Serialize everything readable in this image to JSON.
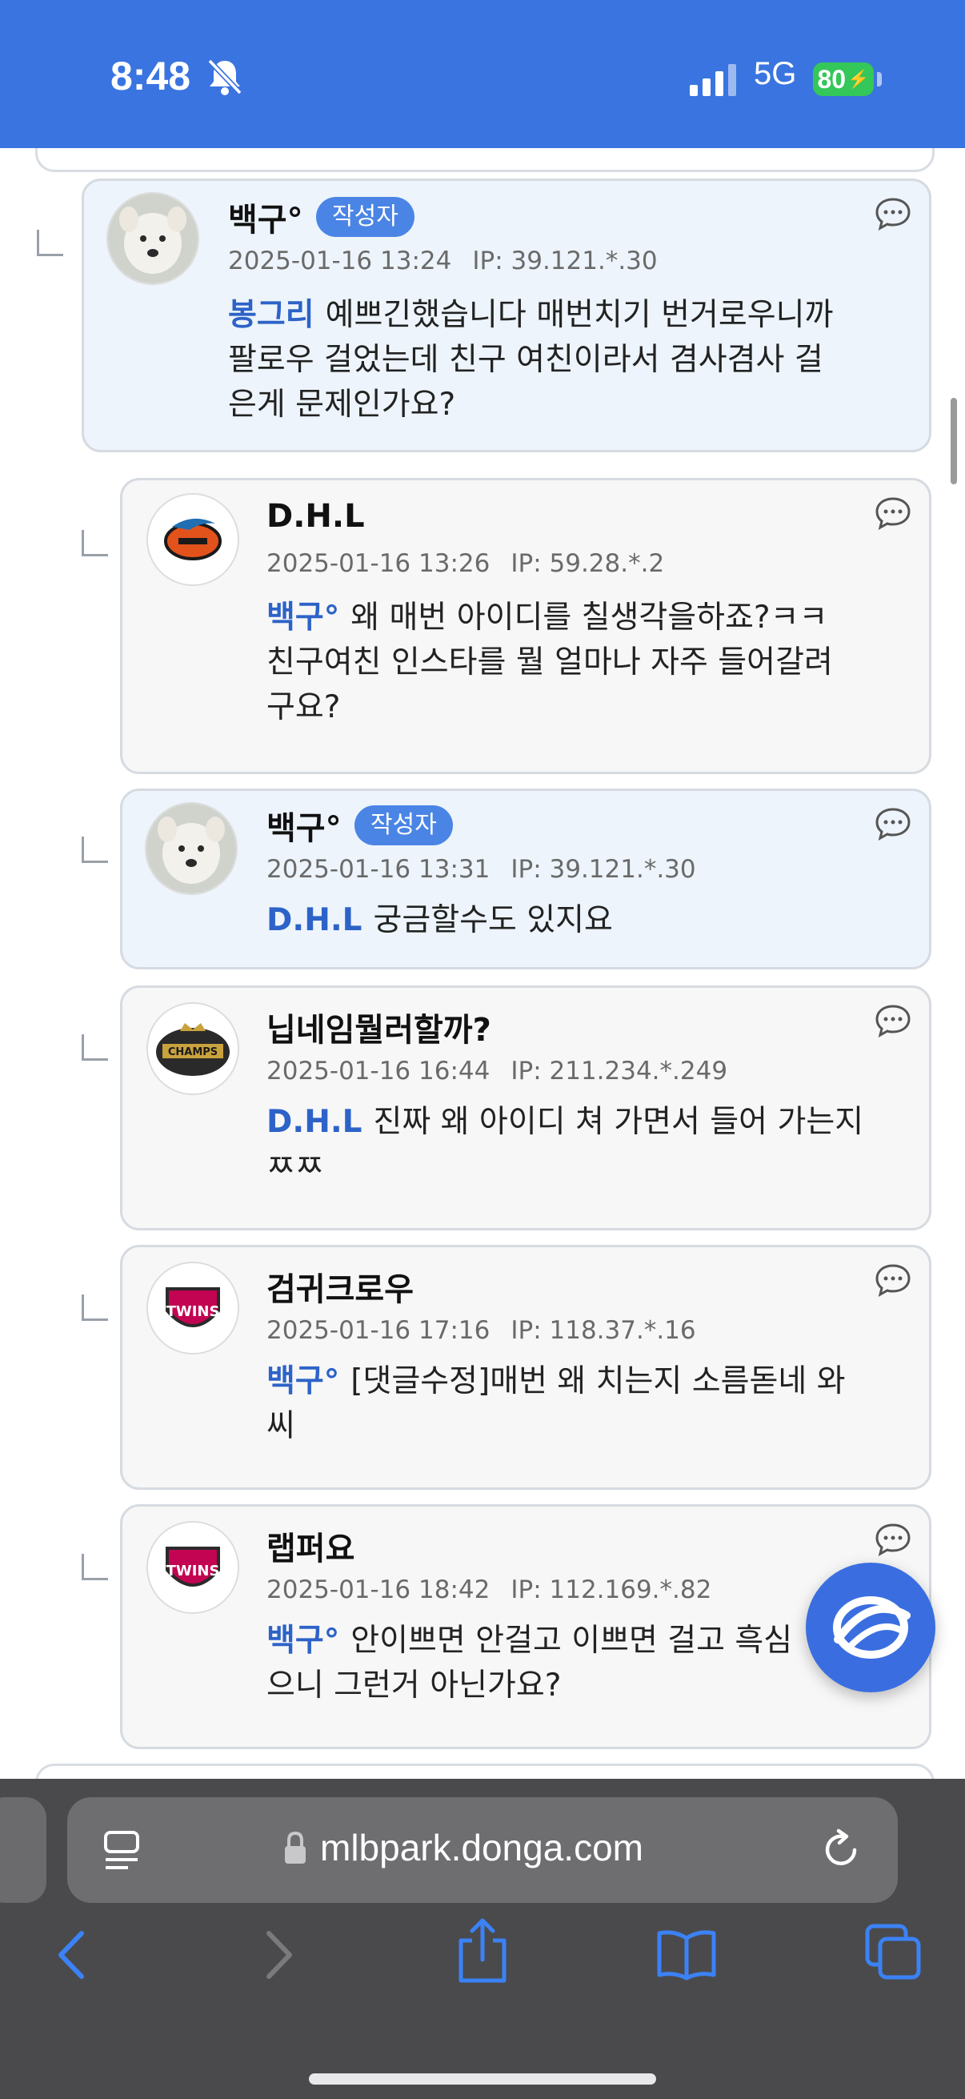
{
  "status_bar": {
    "time": "8:48",
    "network": "5G",
    "battery": "80"
  },
  "comments": [
    {
      "nickname": "백구°",
      "is_author": true,
      "badge": "작성자",
      "date": "2025-01-16 13:24",
      "ip": "IP: 39.121.*.30",
      "mention": "봉그리",
      "lines": [
        "예쁘긴했습니다 매번치기 번거로우니까",
        "팔로우 걸었는데 친구 여친이라서 겸사겸사 걸",
        "은게 문제인가요?"
      ],
      "avatar": "dog-avatar"
    },
    {
      "nickname": "D.H.L",
      "is_author": false,
      "date": "2025-01-16 13:26",
      "ip": "IP: 59.28.*.2",
      "mention": "백구°",
      "lines": [
        "왜 매번 아이디를 칠생각을하죠?ㅋㅋ",
        "친구여친 인스타를 뭘 얼마나 자주 들어갈려",
        "구요?"
      ],
      "avatar": "eagles-logo-avatar"
    },
    {
      "nickname": "백구°",
      "is_author": true,
      "badge": "작성자",
      "date": "2025-01-16 13:31",
      "ip": "IP: 39.121.*.30",
      "mention": "D.H.L",
      "lines": [
        "궁금할수도 있지요"
      ],
      "avatar": "dog-avatar"
    },
    {
      "nickname": "닙네임뭘러할까?",
      "is_author": false,
      "date": "2025-01-16 16:44",
      "ip": "IP: 211.234.*.249",
      "mention": "D.H.L",
      "lines": [
        "진짜 왜 아이디 쳐 가면서 들어 가는지",
        "ㅉㅉ"
      ],
      "avatar": "champions-logo-avatar"
    },
    {
      "nickname": "검귀크로우",
      "is_author": false,
      "date": "2025-01-16 17:16",
      "ip": "IP: 118.37.*.16",
      "mention": "백구°",
      "lines": [
        "[댓글수정]매번 왜 치는지 소름돋네 와",
        "씨"
      ],
      "avatar": "lg-twins-logo-avatar"
    },
    {
      "nickname": "랩퍼요",
      "is_author": false,
      "date": "2025-01-16 18:42",
      "ip": "IP: 112.169.*.82",
      "mention": "백구°",
      "lines": [
        "안이쁘면 안걸고 이쁘면 걸고 흑심",
        "으니 그런거 아닌가요?"
      ],
      "avatar": "lg-twins-logo-avatar"
    }
  ],
  "browser": {
    "url": "mlbpark.donga.com"
  },
  "colors": {
    "status_bar": "#3a74e0",
    "mention": "#2d63c8",
    "author_card": "#edf4fb",
    "badge": "#4a85e6"
  }
}
